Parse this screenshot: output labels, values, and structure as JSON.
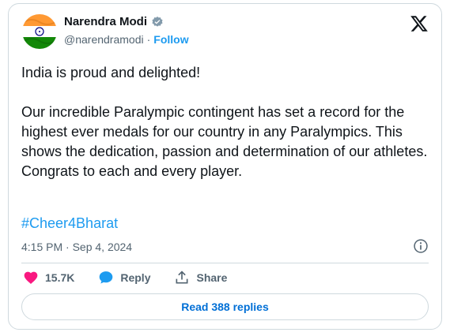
{
  "author": {
    "name": "Narendra Modi",
    "handle": "@narendramodi",
    "separator": "·",
    "follow_label": "Follow",
    "verified_badge": "verified-badge-icon",
    "avatar": "indian-flag-avatar"
  },
  "brand_logo": "x-logo-icon",
  "tweet": {
    "paragraph1": "India is proud and delighted!",
    "paragraph2": "Our incredible Paralympic contingent has set a record for the highest ever medals for our country in any Paralympics. This shows the dedication, passion and determination of our athletes. Congrats to each and every player.",
    "hashtag": "#Cheer4Bharat",
    "timestamp": "4:15 PM · Sep 4, 2024"
  },
  "actions": {
    "like_count": "15.7K",
    "reply_label": "Reply",
    "share_label": "Share"
  },
  "replies_button_label": "Read 388 replies",
  "colors": {
    "accent": "#1d9bf0",
    "like": "#f91880",
    "link": "#006fd6",
    "muted": "#536471",
    "border": "#cfd9de"
  }
}
